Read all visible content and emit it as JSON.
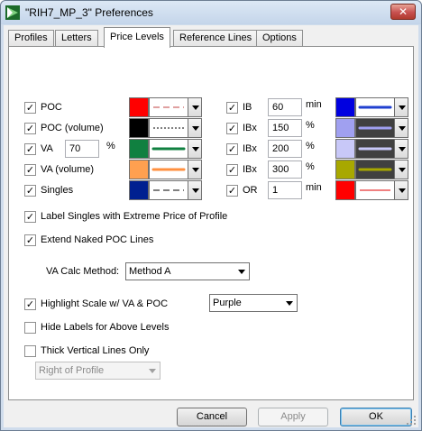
{
  "window": {
    "title": "\"RIH7_MP_3\" Preferences",
    "close_glyph": "✕"
  },
  "tabs": [
    {
      "label": "Profiles"
    },
    {
      "label": "Letters"
    },
    {
      "label": "Price Levels"
    },
    {
      "label": "Reference Lines"
    },
    {
      "label": "Options"
    }
  ],
  "active_tab": "Price Levels",
  "left_levels": [
    {
      "label": "POC",
      "checked": true,
      "color": "#ff0000",
      "line_color": "#c04040",
      "line_style": "dashed"
    },
    {
      "label": "POC (volume)",
      "checked": true,
      "color": "#000000",
      "line_color": "#000000",
      "line_style": "dotted"
    },
    {
      "label": "VA",
      "checked": true,
      "value": "70",
      "unit": "%",
      "color": "#108040",
      "line_color": "#108040",
      "line_style": "thick"
    },
    {
      "label": "VA (volume)",
      "checked": true,
      "color": "#ffa050",
      "line_color": "#ff9040",
      "line_style": "thick"
    },
    {
      "label": "Singles",
      "checked": true,
      "color": "#002090",
      "line_color": "#000000",
      "line_style": "dashed"
    }
  ],
  "right_levels": [
    {
      "label": "IB",
      "checked": true,
      "value": "60",
      "unit": "min",
      "color": "#0000e0",
      "line_color": "#2040d0",
      "line_style": "thick",
      "box_bg": "#ffffff"
    },
    {
      "label": "IBx",
      "checked": true,
      "value": "150",
      "unit": "%",
      "color": "#a0a0f0",
      "line_color": "#a0a0f0",
      "line_style": "thick",
      "box_bg": "#404040"
    },
    {
      "label": "IBx",
      "checked": true,
      "value": "200",
      "unit": "%",
      "color": "#c8c8f8",
      "line_color": "#c8c8f8",
      "line_style": "thick",
      "box_bg": "#404040"
    },
    {
      "label": "IBx",
      "checked": true,
      "value": "300",
      "unit": "%",
      "color": "#a8a800",
      "line_color": "#a8a800",
      "line_style": "thick",
      "box_bg": "#404040"
    },
    {
      "label": "OR",
      "checked": true,
      "value": "1",
      "unit": "min",
      "color": "#ff0000",
      "line_color": "#e00000",
      "line_style": "solid",
      "box_bg": "#ffffff"
    }
  ],
  "options": {
    "label_singles": {
      "label": "Label Singles with Extreme Price of Profile",
      "checked": true
    },
    "extend_poc": {
      "label": "Extend Naked POC Lines",
      "checked": true
    },
    "va_calc": {
      "label": "VA Calc Method:",
      "value": "Method A"
    },
    "highlight_scale": {
      "label": "Highlight Scale w/ VA & POC",
      "checked": true,
      "color_value": "Purple"
    },
    "hide_labels": {
      "label": "Hide Labels for Above Levels",
      "checked": false
    },
    "thick_vertical": {
      "label": "Thick Vertical Lines Only",
      "checked": false,
      "position_value": "Right of Profile"
    }
  },
  "buttons": {
    "cancel": "Cancel",
    "apply": "Apply",
    "ok": "OK"
  },
  "check_glyph": "✓"
}
